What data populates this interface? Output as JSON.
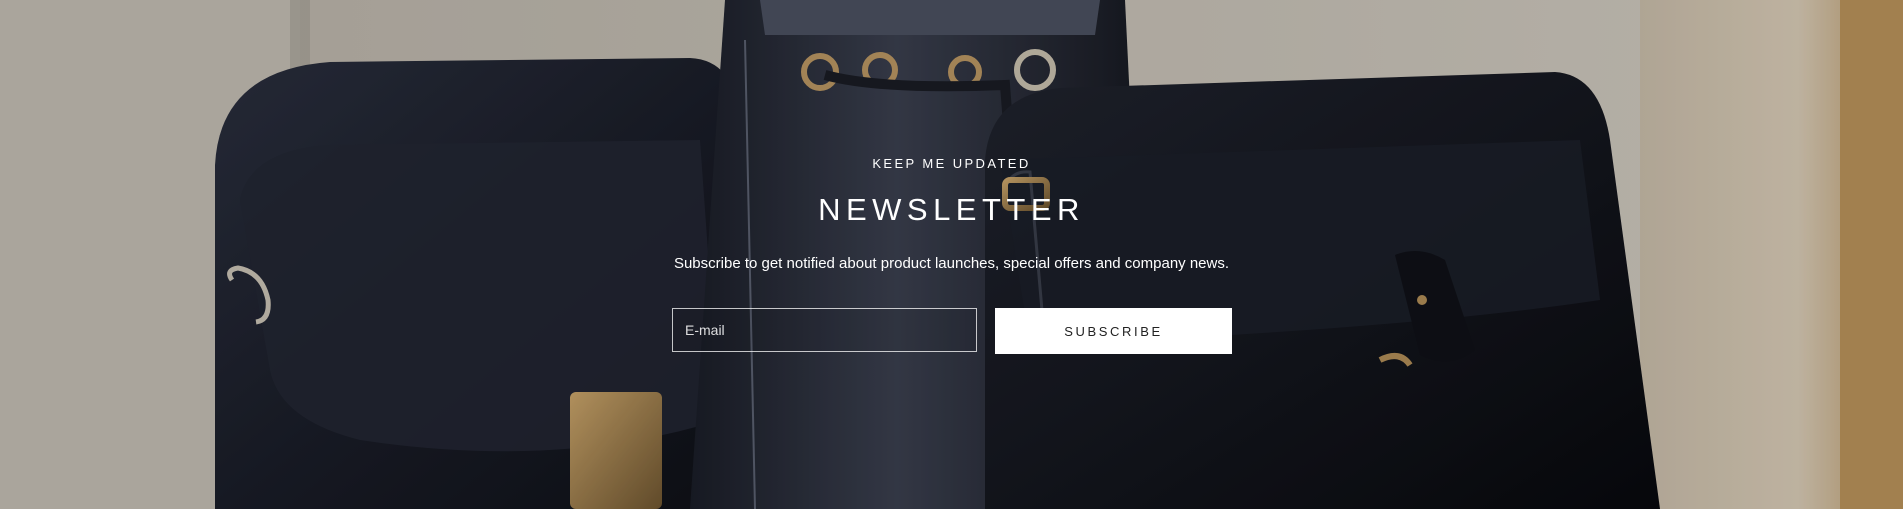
{
  "newsletter": {
    "eyebrow": "KEEP ME UPDATED",
    "title": "NEWSLETTER",
    "description": "Subscribe to get notified about product launches, special offers and company news.",
    "email_placeholder": "E-mail",
    "subscribe_label": "SUBSCRIBE"
  },
  "colors": {
    "text": "#ffffff",
    "button_bg": "#ffffff",
    "button_text": "#222222",
    "wall": "#b9b3aa",
    "leather": "#1c1f2a",
    "hardware": "#b08d57"
  },
  "background": {
    "image_subject": "navy-leather-bags-photo"
  }
}
